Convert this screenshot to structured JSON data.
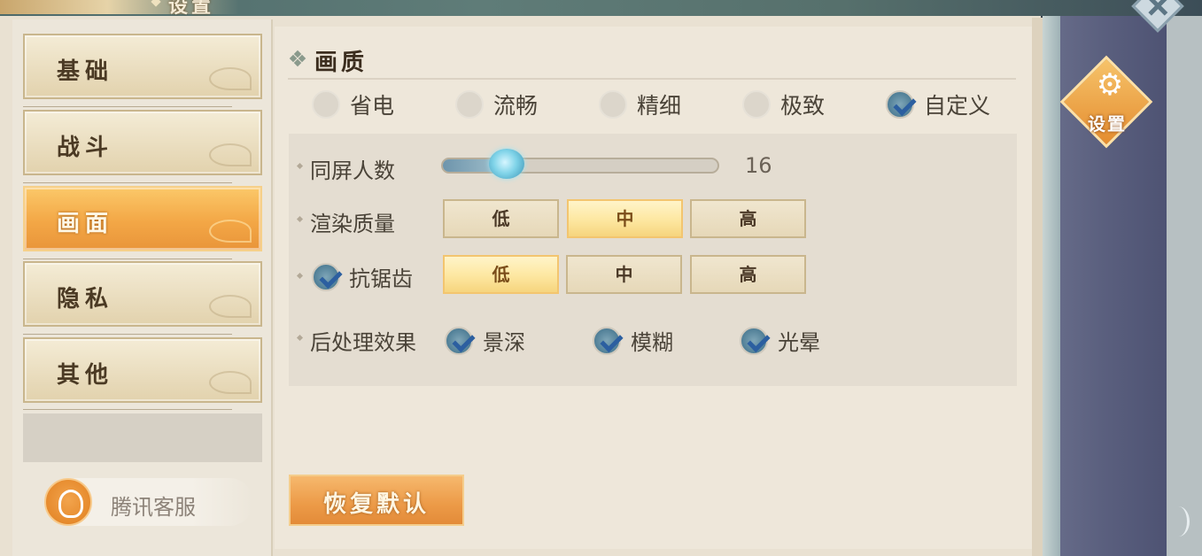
{
  "window": {
    "title": "设置"
  },
  "sidebar": {
    "items": [
      {
        "label": "基础",
        "active": false
      },
      {
        "label": "战斗",
        "active": false
      },
      {
        "label": "画面",
        "active": true
      },
      {
        "label": "隐私",
        "active": false
      },
      {
        "label": "其他",
        "active": false
      }
    ],
    "service_label": "腾讯客服"
  },
  "section": {
    "title": "画质",
    "presets": [
      {
        "label": "省电",
        "selected": false
      },
      {
        "label": "流畅",
        "selected": false
      },
      {
        "label": "精细",
        "selected": false
      },
      {
        "label": "极致",
        "selected": false
      },
      {
        "label": "自定义",
        "selected": true
      }
    ],
    "screen_players": {
      "label": "同屏人数",
      "value": "16",
      "fraction": 0.2
    },
    "render_quality": {
      "label": "渲染质量",
      "options": [
        "低",
        "中",
        "高"
      ],
      "selected": "中"
    },
    "antialias": {
      "label": "抗锯齿",
      "enabled": true,
      "options": [
        "低",
        "中",
        "高"
      ],
      "selected": "低"
    },
    "post_processing": {
      "label": "后处理效果",
      "items": [
        {
          "label": "景深",
          "checked": true
        },
        {
          "label": "模糊",
          "checked": true
        },
        {
          "label": "光晕",
          "checked": true
        }
      ]
    },
    "reset_label": "恢复默认"
  },
  "side_tabs": [
    {
      "label": "设置",
      "icon": "gears-icon",
      "active": true
    }
  ],
  "colors": {
    "accent_orange": "#f0a042",
    "check_blue": "#2c5fa0",
    "knob_cyan": "#7fd3e8"
  }
}
